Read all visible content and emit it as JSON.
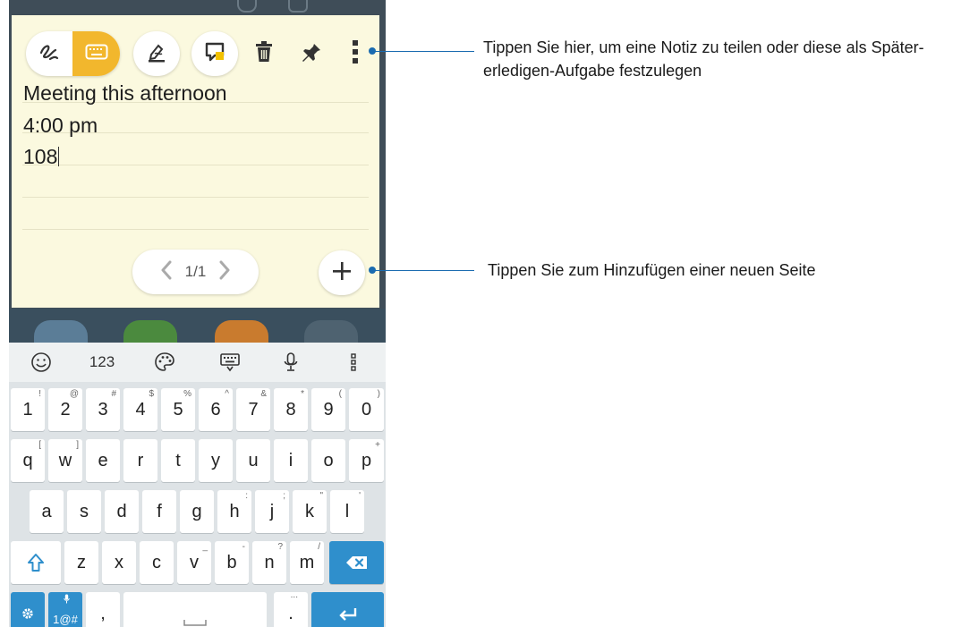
{
  "note": {
    "lines": [
      "Meeting this afternoon",
      "4:00 pm",
      "108"
    ],
    "page_indicator": "1/1"
  },
  "toolbar": {
    "icons": [
      "handwriting-icon",
      "keyboard-icon",
      "ink-style-icon",
      "memo-icon",
      "trash-icon",
      "pin-icon",
      "more-icon"
    ],
    "accent": "#f2b72d"
  },
  "keyboard": {
    "suggestion_bar": {
      "numbers_label": "123"
    },
    "rows": {
      "numbers": [
        {
          "k": "1",
          "s": "!"
        },
        {
          "k": "2",
          "s": "@"
        },
        {
          "k": "3",
          "s": "#"
        },
        {
          "k": "4",
          "s": "$"
        },
        {
          "k": "5",
          "s": "%"
        },
        {
          "k": "6",
          "s": "^"
        },
        {
          "k": "7",
          "s": "&"
        },
        {
          "k": "8",
          "s": "*"
        },
        {
          "k": "9",
          "s": "("
        },
        {
          "k": "0",
          "s": ")"
        }
      ],
      "top": [
        {
          "k": "q",
          "s": "["
        },
        {
          "k": "w",
          "s": "]"
        },
        {
          "k": "e",
          "s": ""
        },
        {
          "k": "r",
          "s": ""
        },
        {
          "k": "t",
          "s": ""
        },
        {
          "k": "y",
          "s": ""
        },
        {
          "k": "u",
          "s": ""
        },
        {
          "k": "i",
          "s": ""
        },
        {
          "k": "o",
          "s": ""
        },
        {
          "k": "p",
          "s": "+"
        }
      ],
      "middle": [
        {
          "k": "a",
          "s": ""
        },
        {
          "k": "s",
          "s": ""
        },
        {
          "k": "d",
          "s": ""
        },
        {
          "k": "f",
          "s": ""
        },
        {
          "k": "g",
          "s": ""
        },
        {
          "k": "h",
          "s": ":"
        },
        {
          "k": "j",
          "s": ";"
        },
        {
          "k": "k",
          "s": "\""
        },
        {
          "k": "l",
          "s": "'"
        }
      ],
      "bottom": [
        {
          "k": "z",
          "s": ""
        },
        {
          "k": "x",
          "s": ""
        },
        {
          "k": "c",
          "s": ""
        },
        {
          "k": "v",
          "s": "_"
        },
        {
          "k": "b",
          "s": "-"
        },
        {
          "k": "n",
          "s": "?"
        },
        {
          "k": "m",
          "s": "/"
        }
      ]
    },
    "symbols_key": "1@#",
    "comma_key": ",",
    "period_key": ".",
    "period_sup": "...",
    "key_color": "#2f8fcc"
  },
  "callouts": {
    "more_menu": "Tippen Sie hier, um eine Notiz zu teilen oder diese als Später-erledigen-Aufgabe festzulegen",
    "add_page": "Tippen Sie zum Hinzufügen einer neuen Seite",
    "color": "#1a6bb0"
  }
}
